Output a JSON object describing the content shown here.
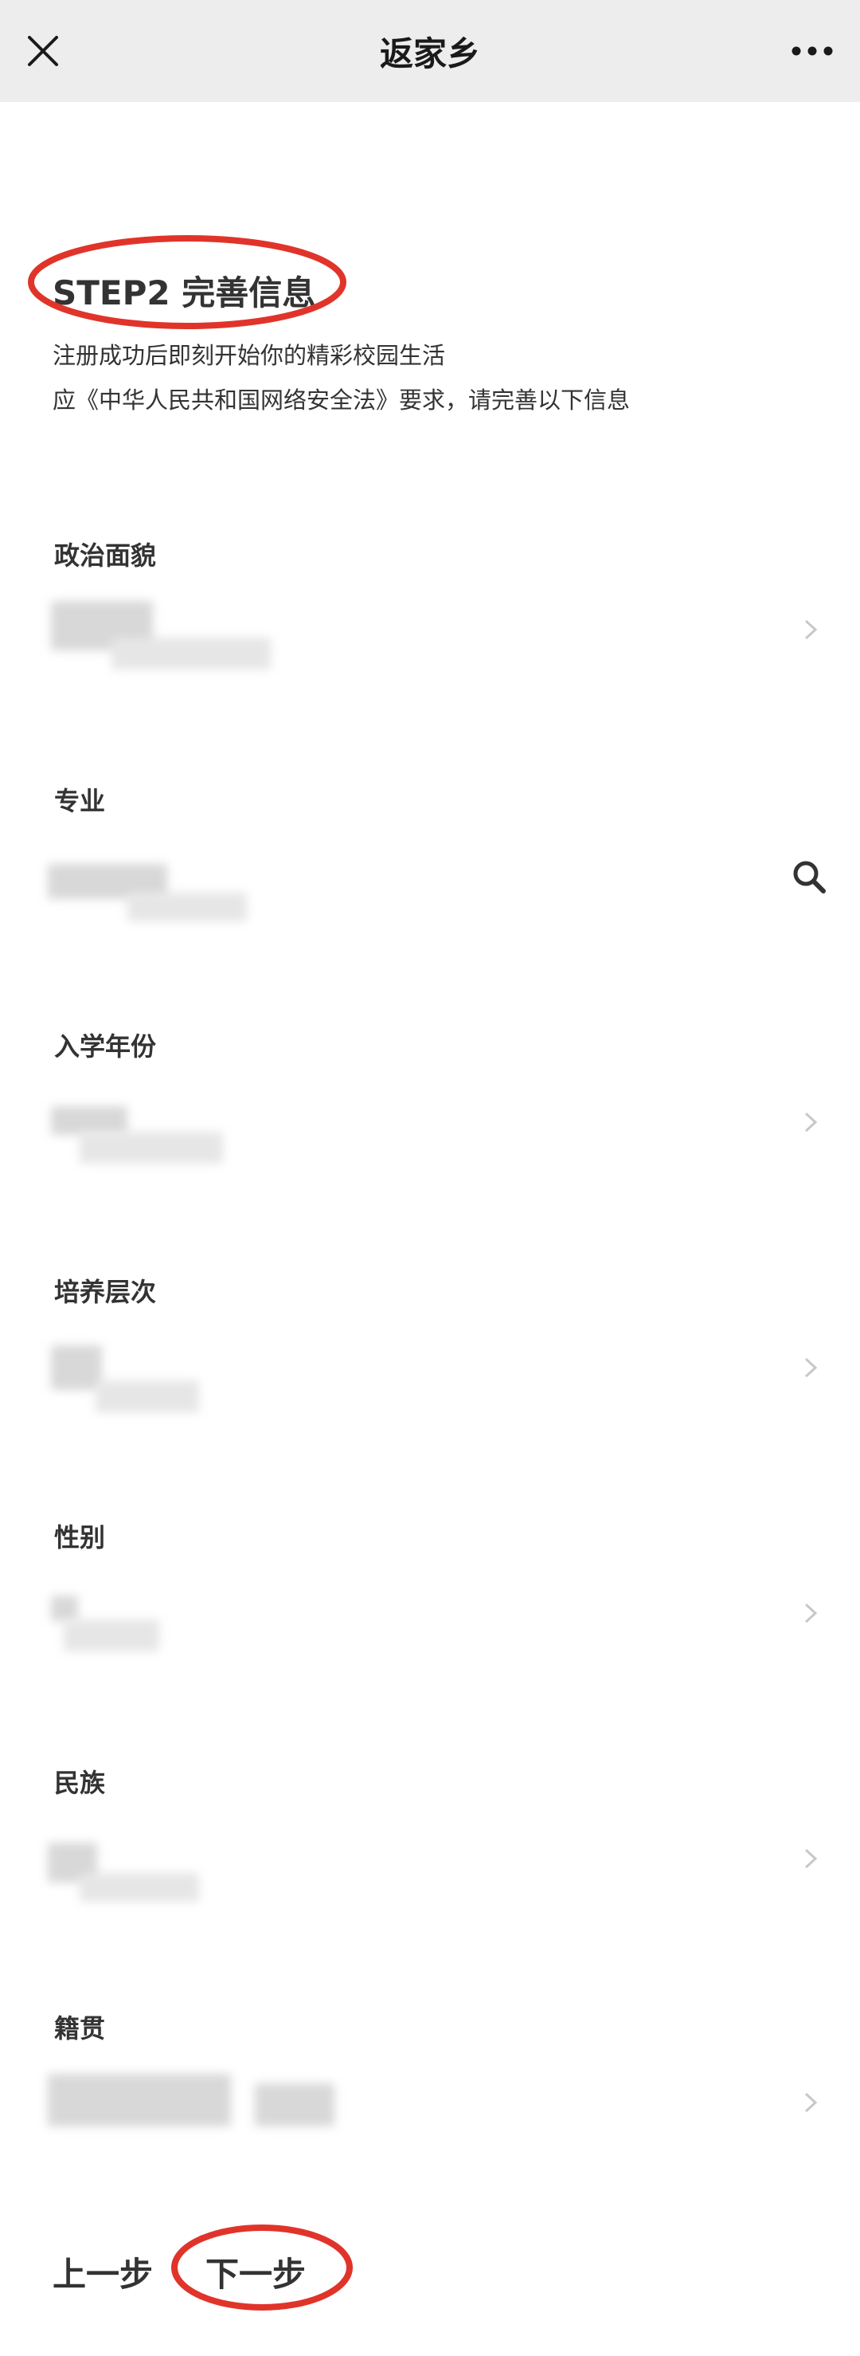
{
  "nav": {
    "title": "返家乡",
    "close_icon": "close-icon",
    "more_icon": "more-dots-icon"
  },
  "step": {
    "title": "STEP2 完善信息",
    "subtitle_1": "注册成功后即刻开始你的精彩校园生活",
    "subtitle_2": "应《中华人民共和国网络安全法》要求，请完善以下信息"
  },
  "fields": [
    {
      "label": "政治面貌",
      "action_icon": "chevron-right-icon"
    },
    {
      "label": "专业",
      "action_icon": "search-icon"
    },
    {
      "label": "入学年份",
      "action_icon": "chevron-right-icon"
    },
    {
      "label": "培养层次",
      "action_icon": "chevron-right-icon"
    },
    {
      "label": "性别",
      "action_icon": "chevron-right-icon"
    },
    {
      "label": "民族",
      "action_icon": "chevron-right-icon"
    },
    {
      "label": "籍贯",
      "action_icon": "chevron-right-icon"
    }
  ],
  "footer": {
    "prev_label": "上一步",
    "next_label": "下一步"
  },
  "colors": {
    "navbar_bg": "#ededed",
    "annotation_red": "#e0342a",
    "text": "#333333",
    "chevron": "#c8c8c8"
  }
}
